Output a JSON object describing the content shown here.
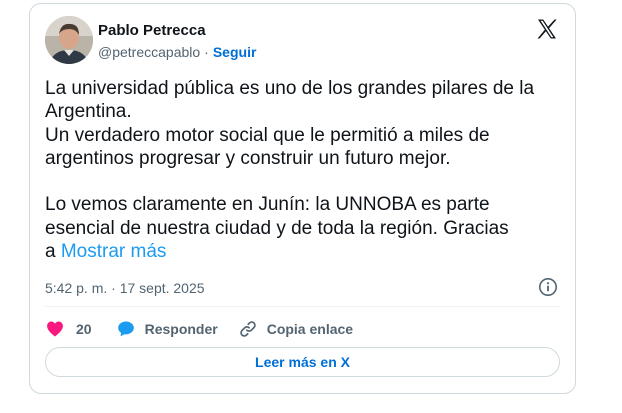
{
  "tweet": {
    "author_name": "Pablo Petrecca",
    "handle": "@petreccapablo",
    "separator": "·",
    "follow_label": "Seguir",
    "text_lines": [
      "La universidad pública es uno de los grandes pilares de la",
      "Argentina.",
      "Un verdadero motor social que le permitió a miles de",
      "argentinos progresar y construir un futuro mejor.",
      "Lo vemos claramente en Junín: la UNNOBA es parte",
      "esencial de nuestra ciudad y de toda la región. Gracias",
      "a"
    ],
    "show_more_label": "Mostrar más",
    "timestamp": "5:42 p. m. · 17 sept. 2025",
    "likes_count": "20",
    "reply_label": "Responder",
    "copy_link_label": "Copia enlace",
    "read_more_label": "Leer más en X"
  },
  "icons": {
    "brand": "x-logo-icon",
    "info": "info-icon",
    "like": "heart-icon",
    "reply": "speech-bubble-icon",
    "copy": "link-icon"
  },
  "colors": {
    "text": "#0f1419",
    "secondary": "#536471",
    "link": "#006fd6",
    "more_link": "#1d9bf0",
    "heart": "#f91880",
    "reply_bubble": "#1d9bf0",
    "border": "#cfd9de"
  }
}
